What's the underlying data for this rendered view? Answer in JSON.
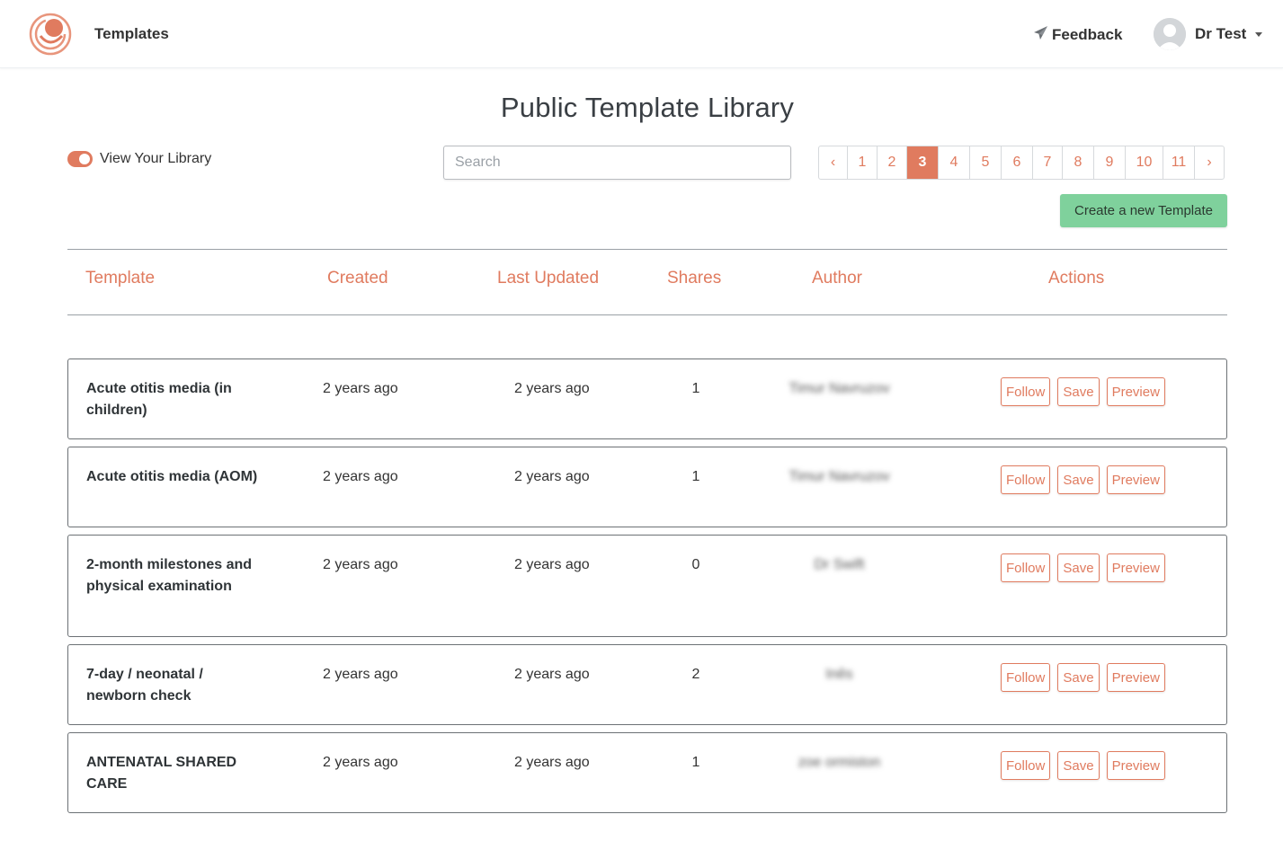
{
  "nav": {
    "templates_link": "Templates",
    "feedback_label": "Feedback",
    "user_name": "Dr Test"
  },
  "page": {
    "title": "Public Template Library",
    "toggle_label": "View Your Library",
    "toggle_on": true,
    "search_placeholder": "Search",
    "create_button": "Create a new Template"
  },
  "pagination": {
    "prev": "‹",
    "next": "›",
    "pages": [
      "1",
      "2",
      "3",
      "4",
      "5",
      "6",
      "7",
      "8",
      "9",
      "10",
      "11"
    ],
    "current": "3"
  },
  "table": {
    "headers": [
      "Template",
      "Created",
      "Last Updated",
      "Shares",
      "Author",
      "Actions"
    ],
    "actions": [
      "Follow",
      "Save",
      "Preview"
    ],
    "rows": [
      {
        "name": "Acute otitis media (in children)",
        "created": "2 years ago",
        "updated": "2 years ago",
        "shares": "1",
        "author": "Timur Navruzov"
      },
      {
        "name": "Acute otitis media (AOM)",
        "created": "2 years ago",
        "updated": "2 years ago",
        "shares": "1",
        "author": "Timur Navruzov"
      },
      {
        "name": "2-month milestones and physical examination",
        "created": "2 years ago",
        "updated": "2 years ago",
        "shares": "0",
        "author": "Dr Swift"
      },
      {
        "name": "7-day / neonatal / newborn check",
        "created": "2 years ago",
        "updated": "2 years ago",
        "shares": "2",
        "author": "Inês"
      },
      {
        "name": "ANTENATAL SHARED CARE",
        "created": "2 years ago",
        "updated": "2 years ago",
        "shares": "1",
        "author": "zoe ormiston"
      }
    ]
  },
  "colors": {
    "accent": "#e07b5f",
    "create_button": "#7fd19c",
    "text": "#2f3437"
  },
  "icons": {
    "logo": "spiral-logo-icon",
    "feedback": "paper-plane-icon",
    "avatar": "user-avatar-icon",
    "dropdown": "caret-down-icon"
  }
}
